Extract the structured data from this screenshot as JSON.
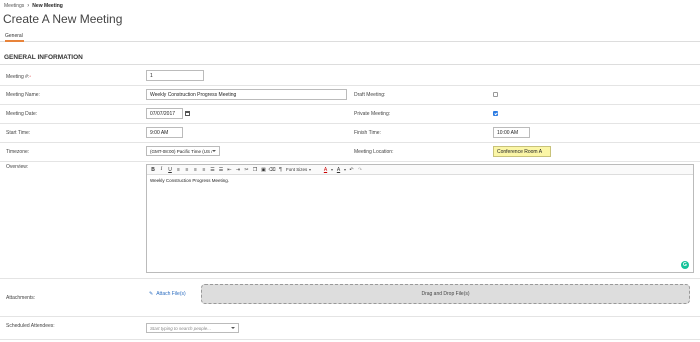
{
  "breadcrumb": {
    "parent": "Meetings",
    "current": "New Meeting"
  },
  "page": {
    "title": "Create A New Meeting"
  },
  "tabs": [
    {
      "label": "General",
      "active": true
    }
  ],
  "accent_color": "#e8833a",
  "section": {
    "title": "GENERAL INFORMATION"
  },
  "form": {
    "meeting_number": {
      "label": "Meeting #:",
      "required_mark": "*",
      "value": "1"
    },
    "meeting_name": {
      "label": "Meeting Name:",
      "value": "Weekly Construction Progress Meeting"
    },
    "draft_meeting": {
      "label": "Draft Meeting:",
      "checked": false
    },
    "meeting_date": {
      "label": "Meeting Date:",
      "value": "07/07/2017",
      "icon": "calendar-icon"
    },
    "private_meeting": {
      "label": "Private Meeting:",
      "checked": true
    },
    "start_time": {
      "label": "Start Time:",
      "value": "9:00 AM"
    },
    "finish_time": {
      "label": "Finish Time:",
      "value": "10:00 AM"
    },
    "timezone": {
      "label": "Timezone:",
      "value": "(GMT-08:00) Pacific Time (US /"
    },
    "meeting_location": {
      "label": "Meeting Location:",
      "value": "Conference Room A"
    },
    "overview": {
      "label": "Overview:",
      "font_sizes_label": "Font Sizes",
      "content": "Weekly Construction Progress Meeting."
    },
    "attachments": {
      "label": "Attachments:",
      "link_label": "Attach File(s)",
      "drop_label": "Drag and Drop File(s)"
    },
    "scheduled_attendees": {
      "label": "Scheduled Attendees:",
      "placeholder": "Start typing to search people..."
    }
  }
}
